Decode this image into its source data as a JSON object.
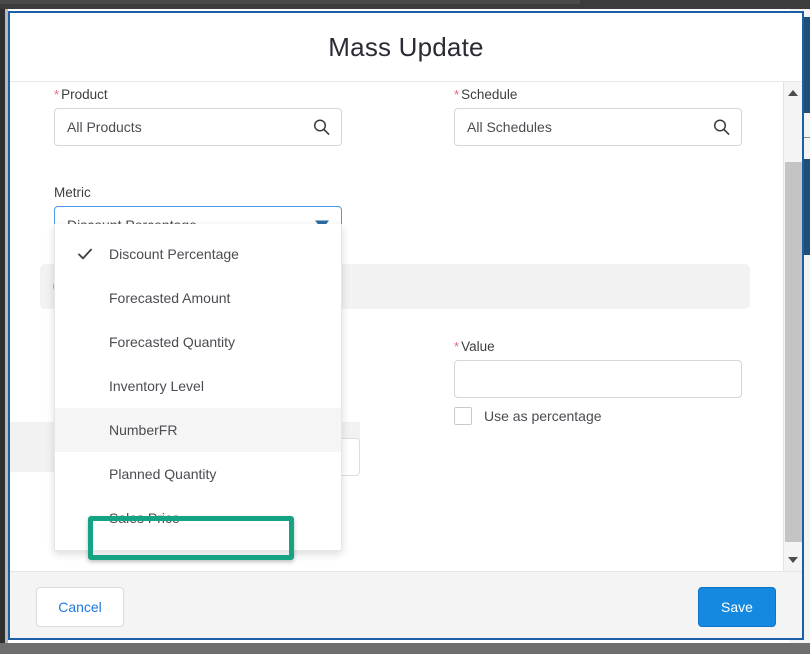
{
  "modal": {
    "title": "Mass Update",
    "fields": {
      "product": {
        "label": "Product",
        "required": true,
        "value": "All Products",
        "icon": "search-icon"
      },
      "schedule": {
        "label": "Schedule",
        "required": true,
        "value": "All Schedules",
        "icon": "search-icon"
      },
      "metric": {
        "label": "Metric",
        "required": false,
        "value": "Discount Percentage",
        "icon": "chevron-down-icon"
      },
      "value": {
        "label": "Value",
        "required": true,
        "value": "",
        "placeholder": ""
      },
      "use_as_percentage": {
        "label": "Use as percentage",
        "checked": false
      }
    },
    "info_banner": {
      "icon": "info-icon",
      "text": ""
    },
    "metric_dropdown": {
      "open": true,
      "selected": "Discount Percentage",
      "highlighted": "NumberFR",
      "options": [
        "Discount Percentage",
        "Forecasted Amount",
        "Forecasted Quantity",
        "Inventory Level",
        "NumberFR",
        "Planned Quantity",
        "Sales Price"
      ]
    },
    "footer": {
      "cancel_label": "Cancel",
      "save_label": "Save"
    },
    "scrollbar": {
      "up_icon": "scroll-up-arrow-icon",
      "down_icon": "scroll-down-arrow-icon"
    }
  },
  "annotation": {
    "target": "NumberFR",
    "color": "#14a383"
  },
  "colors": {
    "accent_blue": "#1589e0",
    "modal_border": "#1b5fa6",
    "required_star": "#e8697f",
    "highlight_green": "#14a383",
    "link_blue": "#1f7ae0"
  }
}
